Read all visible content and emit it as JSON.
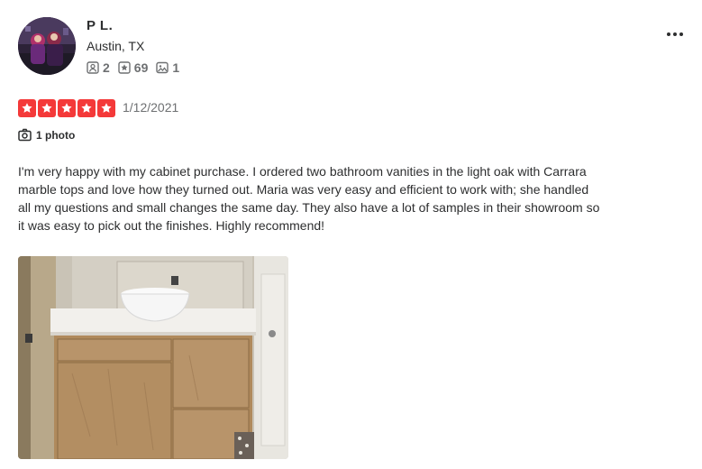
{
  "review": {
    "user": {
      "name": "P L.",
      "location": "Austin, TX",
      "stats": {
        "friends": "2",
        "reviews": "69",
        "photos": "1"
      }
    },
    "rating": 5,
    "rating_max": 5,
    "date": "1/12/2021",
    "photo_count_label": "1 photo",
    "text": "I'm very happy with my cabinet purchase. I ordered two bathroom vanities in the light oak with Carrara marble tops and love how they turned out. Maria was very easy and efficient to work with; she handled all my questions and small changes the same day. They also have a lot of samples in their showroom so it was easy to pick out the finishes. Highly recommend!"
  },
  "icons": {
    "friends": "friends-icon",
    "reviews": "star-square-icon",
    "photos": "image-icon",
    "camera": "camera-icon",
    "more": "more-horizontal-icon"
  },
  "colors": {
    "star_red": "#f43939",
    "text": "#2d2e2f",
    "muted": "#6e7072"
  }
}
